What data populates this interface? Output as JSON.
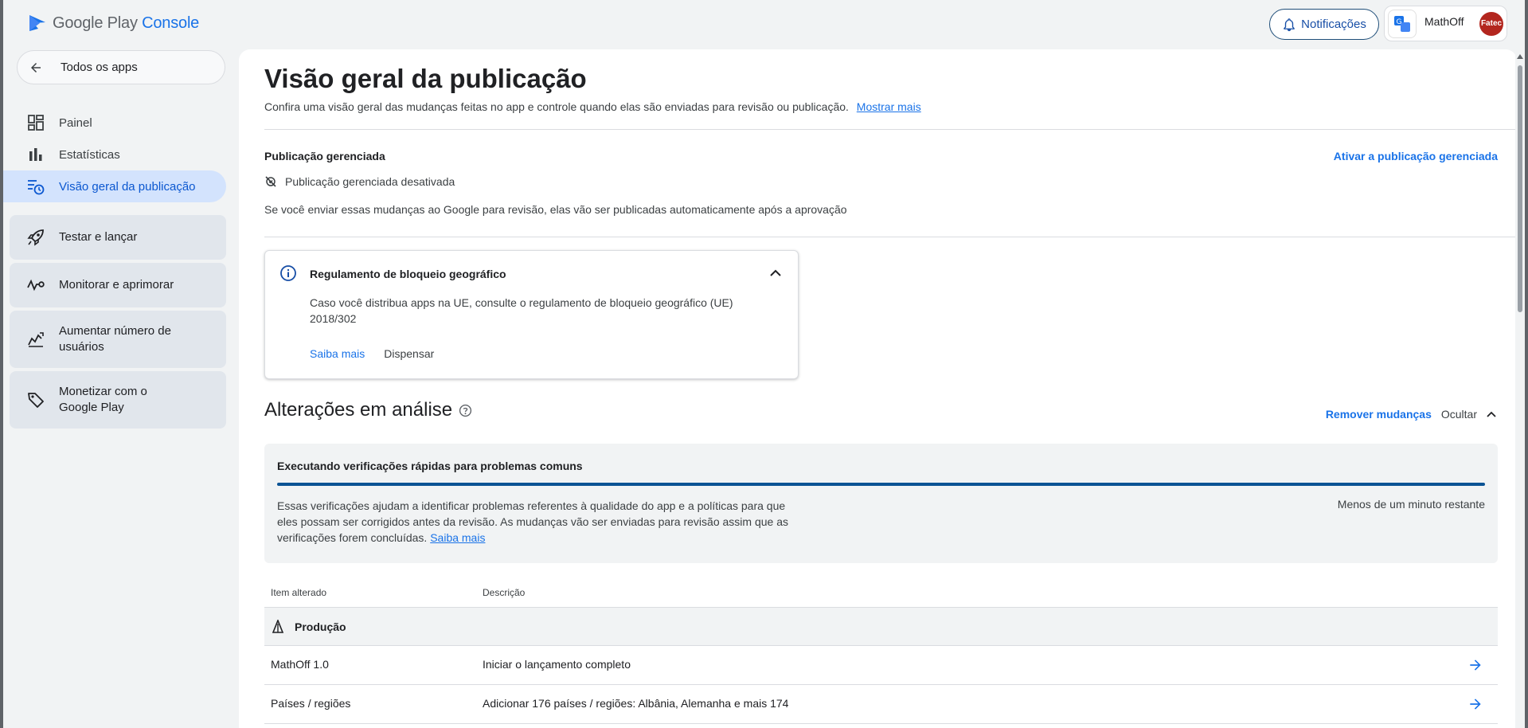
{
  "app": {
    "logo_text": "Google Play",
    "logo_brand": "Console"
  },
  "topbar": {
    "notifications_label": "Notificações",
    "account_name": "MathOff",
    "avatar_text": "Fatec"
  },
  "sidebar": {
    "back_label": "Todos os apps",
    "items": [
      {
        "label": "Painel",
        "icon": "dashboard-icon"
      },
      {
        "label": "Estatísticas",
        "icon": "bar-chart-icon"
      },
      {
        "label": "Visão geral da publicação",
        "icon": "publishing-overview-icon",
        "active": true
      }
    ],
    "groups": [
      {
        "label": "Testar e lançar",
        "icon": "rocket-icon"
      },
      {
        "label": "Monitorar e aprimorar",
        "icon": "monitor-icon"
      },
      {
        "label": "Aumentar número de usuários",
        "icon": "growth-icon"
      },
      {
        "label": "Monetizar com o Google Play",
        "icon": "tag-icon"
      }
    ]
  },
  "main": {
    "title": "Visão geral da publicação",
    "description": "Confira uma visão geral das mudanças feitas no app e controle quando elas são enviadas para revisão ou publicação.",
    "show_more": "Mostrar mais",
    "managed": {
      "label": "Publicação gerenciada",
      "enable_link": "Ativar a publicação gerenciada",
      "status": "Publicação gerenciada desativada",
      "note": "Se você enviar essas mudanças ao Google para revisão, elas vão ser publicadas automaticamente após a aprovação"
    },
    "geo_card": {
      "title": "Regulamento de bloqueio geográfico",
      "body": "Caso você distribua apps na UE, consulte o regulamento de bloqueio geográfico (UE) 2018/302",
      "learn_more": "Saiba mais",
      "dismiss": "Dispensar"
    },
    "changes": {
      "title": "Alterações em análise",
      "remove": "Remover mudanças",
      "hide": "Ocultar",
      "check_title": "Executando verificações rápidas para problemas comuns",
      "check_desc": "Essas verificações ajudam a identificar problemas referentes à qualidade do app e a políticas para que eles possam ser corrigidos antes da revisão. As mudanças vão ser enviadas para revisão assim que as verificações forem concluídas.",
      "check_link": "Saiba mais",
      "check_time": "Menos de um minuto restante",
      "progress": 1.0
    },
    "table": {
      "headers": [
        "Item alterado",
        "Descrição"
      ],
      "group": "Produção",
      "rows": [
        {
          "item": "MathOff 1.0",
          "desc": "Iniciar o lançamento completo"
        },
        {
          "item": "Países / regiões",
          "desc": "Adicionar 176 países / regiões: Albânia, Alemanha e mais 174"
        }
      ]
    }
  },
  "colors": {
    "accent": "#1a73e8",
    "active_bg": "#d3e3fd",
    "progress": "#0b5394"
  }
}
